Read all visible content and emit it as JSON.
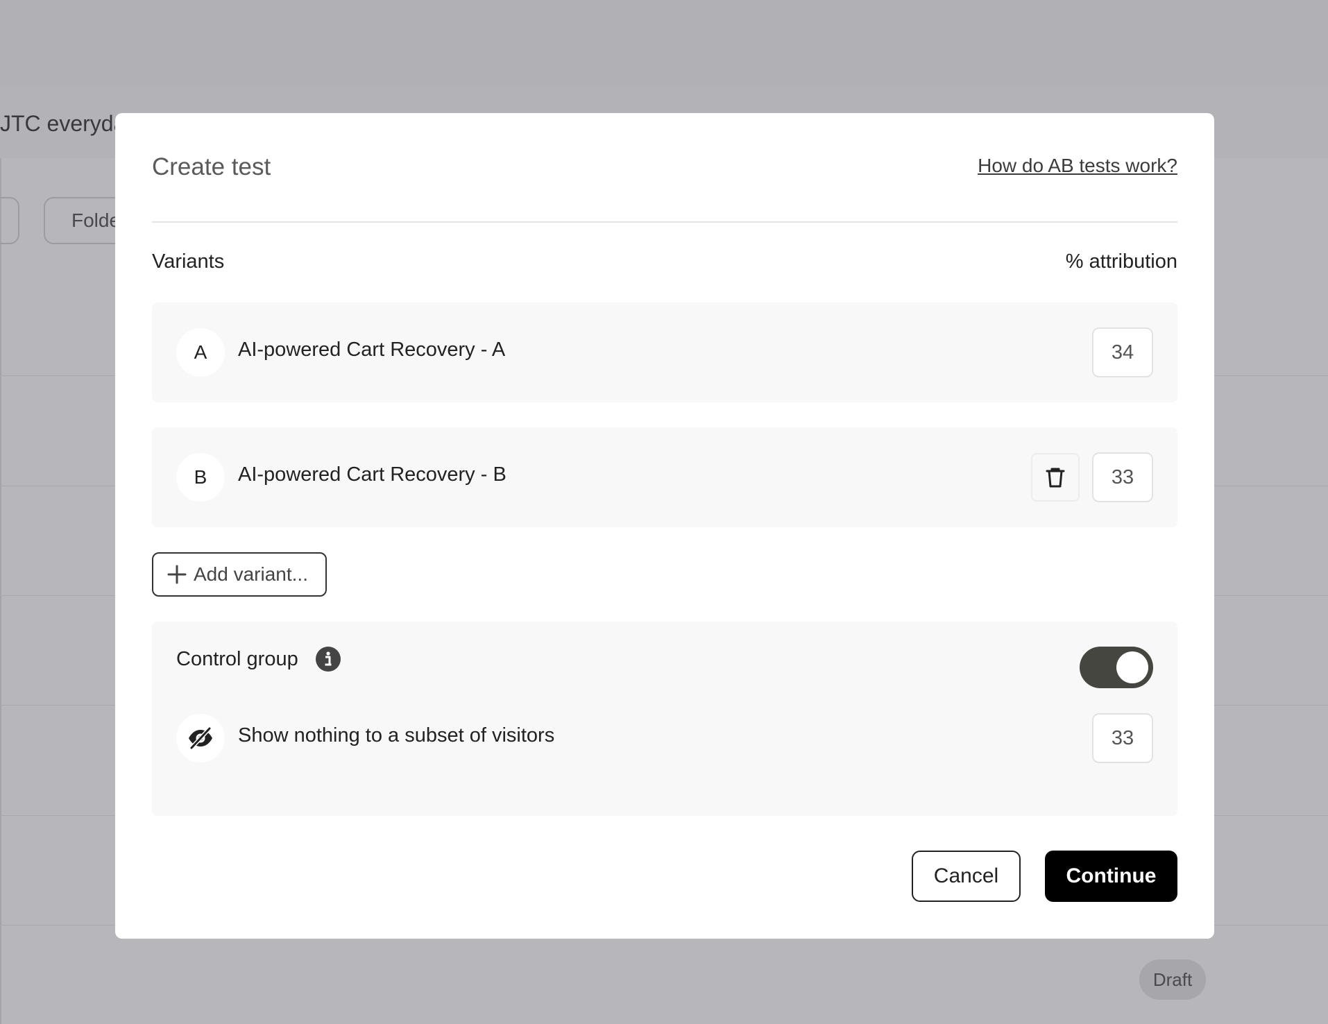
{
  "background": {
    "schedule_text": "JTC everyda",
    "folder_button": "Folde",
    "draft_badge": "Draft"
  },
  "modal": {
    "title": "Create test",
    "help_link": "How do AB tests work?",
    "variants_label": "Variants",
    "attribution_label": "% attribution",
    "variants": [
      {
        "letter": "A",
        "name": "AI-powered Cart Recovery - A",
        "percent": "34"
      },
      {
        "letter": "B",
        "name": "AI-powered Cart Recovery - B",
        "percent": "33"
      }
    ],
    "add_variant_label": "Add variant...",
    "control_group": {
      "label": "Control group",
      "enabled": true,
      "description": "Show nothing to a subset of visitors",
      "percent": "33"
    },
    "cancel_label": "Cancel",
    "continue_label": "Continue"
  }
}
